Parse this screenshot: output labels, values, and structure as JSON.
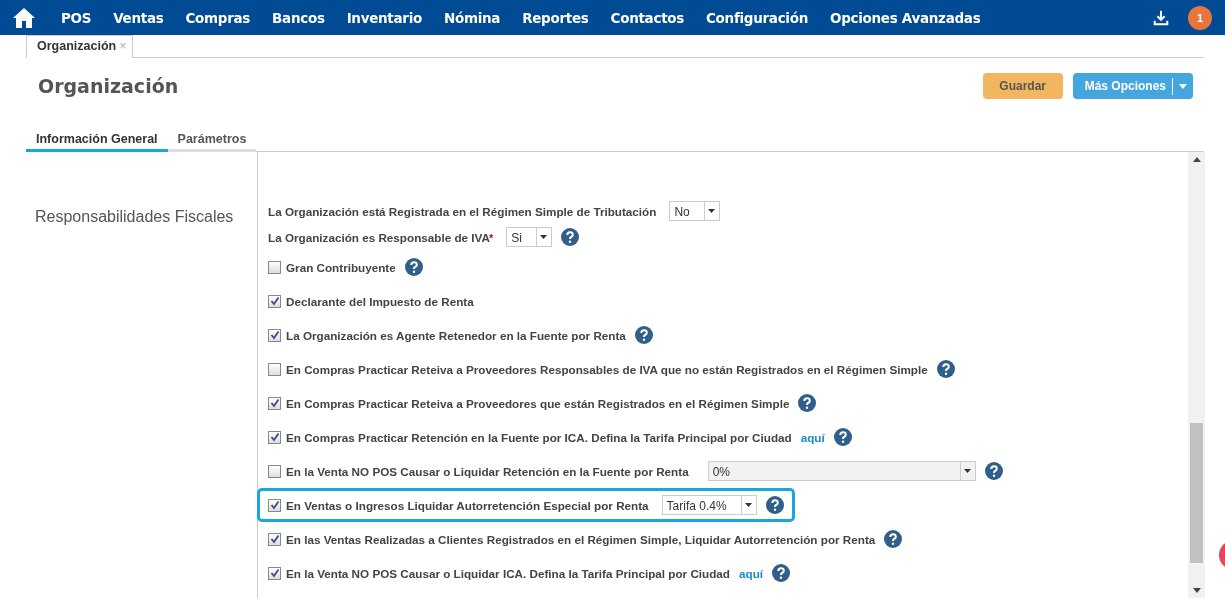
{
  "nav": {
    "items": [
      "POS",
      "Ventas",
      "Compras",
      "Bancos",
      "Inventario",
      "Nómina",
      "Reportes",
      "Contactos",
      "Configuración",
      "Opciones Avanzadas"
    ],
    "badge": "1"
  },
  "doc_tabs": [
    {
      "label": "Organización",
      "close": "×",
      "selected": true
    }
  ],
  "page_title": "Organización",
  "actions": {
    "save": "Guardar",
    "more": "Más Opciones"
  },
  "tabs": [
    {
      "label": "Información General",
      "selected": true
    },
    {
      "label": "Parámetros",
      "selected": false
    }
  ],
  "section": {
    "title": "Responsabilidades Fiscales",
    "rows": [
      {
        "kind": "select",
        "label": "La Organización está Registrada en el Régimen Simple de Tributación",
        "select": {
          "value": "No",
          "disabled": false
        },
        "help": false,
        "highlighted": false
      },
      {
        "kind": "select",
        "label": "La Organización es Responsable de IVA",
        "required": "*",
        "select": {
          "value": "Si",
          "disabled": false
        },
        "help": true,
        "highlighted": false
      },
      {
        "kind": "check",
        "label": "Gran Contribuyente",
        "checked": false,
        "help": true,
        "highlighted": false
      },
      {
        "kind": "check",
        "label": "Declarante del Impuesto de Renta",
        "checked": true,
        "help": false,
        "highlighted": false
      },
      {
        "kind": "check",
        "label": "La Organización es Agente Retenedor en la Fuente por Renta",
        "checked": true,
        "help": true,
        "highlighted": false
      },
      {
        "kind": "check",
        "label": "En Compras Practicar Reteiva a Proveedores Responsables de IVA que no están Registrados en el Régimen Simple",
        "checked": false,
        "help": true,
        "highlighted": false
      },
      {
        "kind": "check",
        "label": "En Compras Practicar Reteiva a Proveedores que están Registrados en el Régimen Simple",
        "checked": true,
        "help": true,
        "highlighted": false
      },
      {
        "kind": "check",
        "label": "En Compras Practicar Retención en la Fuente por ICA. Defina la Tarifa Principal por Ciudad",
        "link": "aquí",
        "checked": true,
        "help": true,
        "highlighted": false
      },
      {
        "kind": "check",
        "label": "En la Venta NO POS Causar o Liquidar Retención en la Fuente por Renta",
        "checked": false,
        "select": {
          "value": "0%",
          "disabled": true
        },
        "help": true,
        "highlighted": false
      },
      {
        "kind": "check",
        "label": "En Ventas o Ingresos Liquidar Autorretención Especial por Renta",
        "checked": true,
        "select": {
          "value": "Tarifa 0.4%",
          "disabled": false
        },
        "help": true,
        "highlighted": true
      },
      {
        "kind": "check",
        "label": "En las Ventas Realizadas a Clientes Registrados en el Régimen Simple, Liquidar Autorretención por Renta",
        "checked": true,
        "help": true,
        "highlighted": false
      },
      {
        "kind": "check",
        "label": "En la Venta NO POS Causar o Liquidar ICA. Defina la Tarifa Principal por Ciudad",
        "link": "aquí",
        "checked": true,
        "help": true,
        "highlighted": false
      }
    ]
  }
}
